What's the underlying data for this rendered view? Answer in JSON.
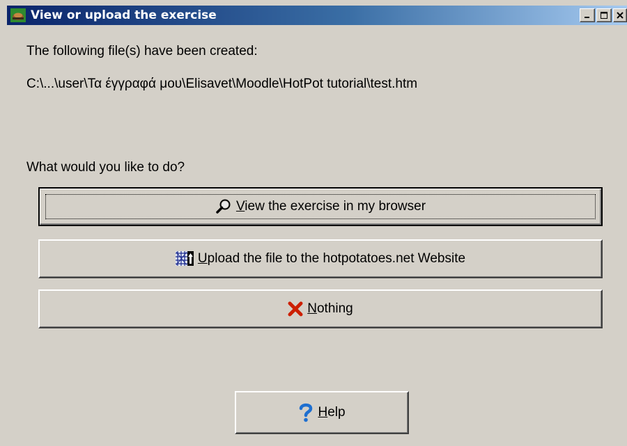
{
  "window": {
    "title": "View or upload the exercise",
    "app_icon": "hotpotatoes-icon",
    "controls": {
      "minimize_icon": "minimize-icon",
      "maximize_icon": "maximize-icon",
      "close_icon": "close-icon"
    }
  },
  "content": {
    "created_label": "The following file(s) have been created:",
    "file_path": "C:\\...\\user\\Τα έγγραφά μου\\Elisavet\\Moodle\\HotPot tutorial\\test.htm",
    "question": "What would you like to do?"
  },
  "buttons": {
    "view": {
      "accel": "V",
      "rest": "iew the exercise in my browser",
      "icon": "magnifier-icon"
    },
    "upload": {
      "accel": "U",
      "rest": "pload the file to the hotpotatoes.net Website",
      "icon": "web-upload-icon"
    },
    "nothing": {
      "accel": "N",
      "rest": "othing",
      "icon": "red-x-icon",
      "icon_color": "#cc1f00"
    },
    "help": {
      "accel": "H",
      "rest": "elp",
      "icon": "question-mark-icon",
      "icon_color": "#1e6fd0"
    }
  },
  "colors": {
    "titlebar_start": "#0a246a",
    "titlebar_end": "#a6caf0",
    "face": "#d4d0c8"
  }
}
